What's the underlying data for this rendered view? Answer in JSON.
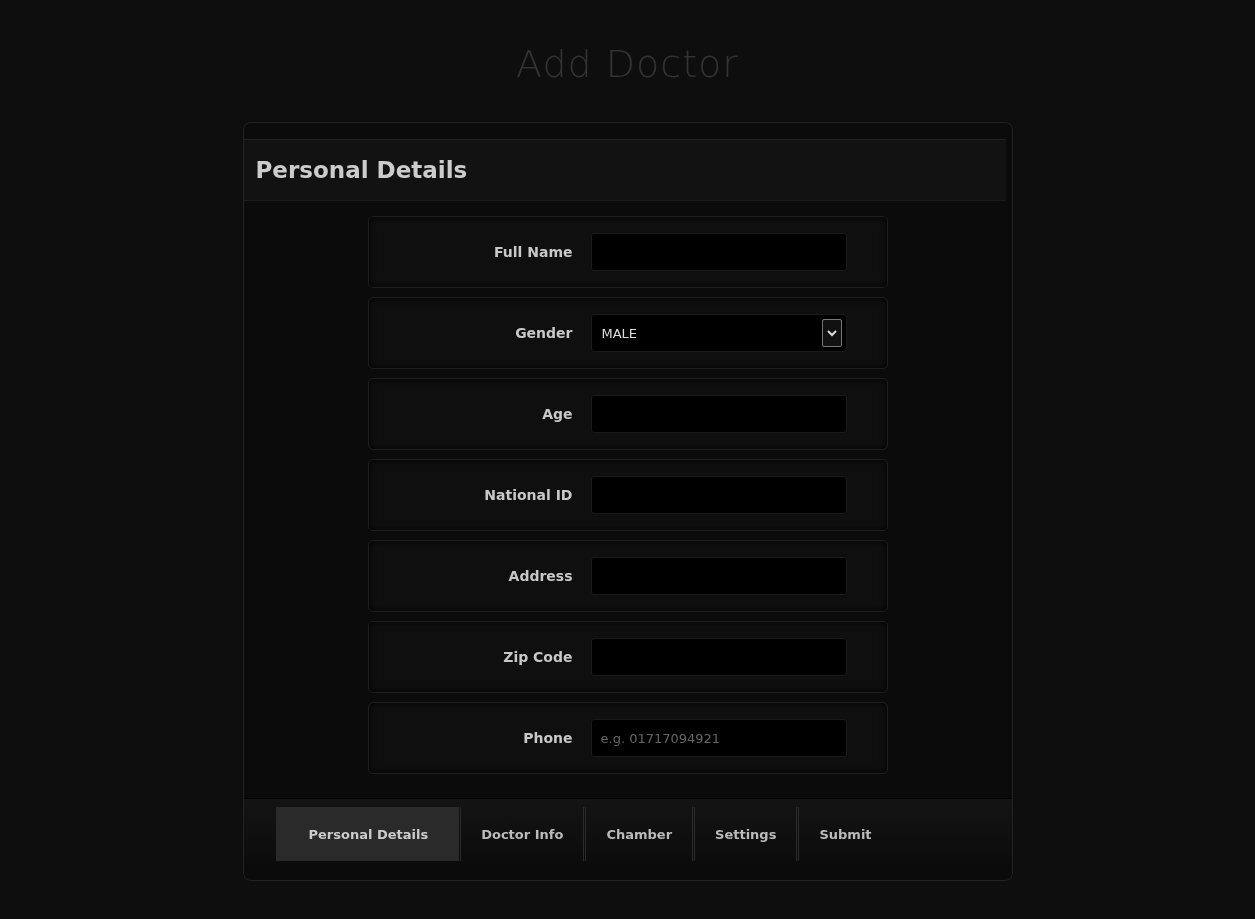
{
  "page_title": "Add Doctor",
  "section": {
    "title": "Personal Details"
  },
  "fields": [
    {
      "label": "Full Name",
      "kind": "text"
    },
    {
      "label": "Gender",
      "kind": "select",
      "value": "MALE"
    },
    {
      "label": "Age",
      "kind": "text"
    },
    {
      "label": "National ID",
      "kind": "text"
    },
    {
      "label": "Address",
      "kind": "text"
    },
    {
      "label": "Zip Code",
      "kind": "text"
    },
    {
      "label": "Phone",
      "kind": "text",
      "placeholder": "e.g. 01717094921"
    }
  ],
  "tabs": [
    {
      "label": "Personal Details",
      "selected": true
    },
    {
      "label": "Doctor Info",
      "selected": false
    },
    {
      "label": "Chamber",
      "selected": false
    },
    {
      "label": "Settings",
      "selected": false
    },
    {
      "label": "Submit",
      "selected": false
    }
  ]
}
